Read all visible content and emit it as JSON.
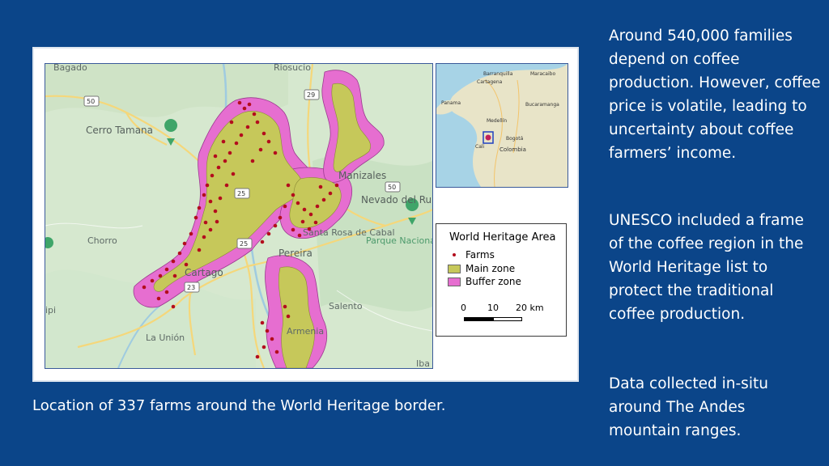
{
  "slide": {
    "background_color": "#0b4589",
    "caption": "Location of 337 farms around the World Heritage border.",
    "paragraphs": [
      "Around 540,000 families depend on coffee production. However, coffee price is volatile, leading to uncertainty about coffee farmers’ income.",
      "UNESCO included a frame of the coffee region in the World Heritage list to protect the traditional coffee production.",
      "Data collected in-situ around The Andes mountain ranges."
    ]
  },
  "map": {
    "place_labels": {
      "bagado": "Bagado",
      "riosucio": "Riosucio",
      "cerro_tamana": "Cerro Tamana",
      "manizales": "Manizales",
      "nevado_del_ruiz": "Nevado del Ruiz",
      "chorro": "Chorro",
      "santa_rosa": "Santa Rosa de Cabal",
      "pereira": "Pereira",
      "parque_nacional": "Parque Nacional Natural Los Nevados",
      "cartago": "Cartago",
      "salento": "Salento",
      "la_union": "La Unión",
      "armenia": "Armenia",
      "pipi": "ipi",
      "ibague": "Iba"
    },
    "road_numbers": [
      "50",
      "29",
      "25",
      "50",
      "25",
      "23",
      "29"
    ],
    "colors": {
      "main_zone": "#c6c85a",
      "buffer_zone": "#e66ed0",
      "farms": "#b30d1d",
      "water": "#a7d3e6",
      "land": "#d9ead0"
    },
    "inset": {
      "labels": {
        "panama": "Panama",
        "colombia": "Colombia",
        "medellin": "Medellín",
        "bogota": "Bogotá",
        "cali": "Cali",
        "barranquilla": "Barranquilla",
        "cartagena": "Cartagena",
        "bucaramanga": "Bucaramanga",
        "maracaibo": "Maracaibo"
      }
    },
    "legend": {
      "title": "World Heritage Area",
      "items": [
        {
          "label": "Farms",
          "type": "point"
        },
        {
          "label": "Main zone",
          "type": "fill"
        },
        {
          "label": "Buffer zone",
          "type": "fill"
        }
      ],
      "scale": {
        "ticks": [
          "0",
          "10",
          "20 km"
        ]
      }
    }
  }
}
